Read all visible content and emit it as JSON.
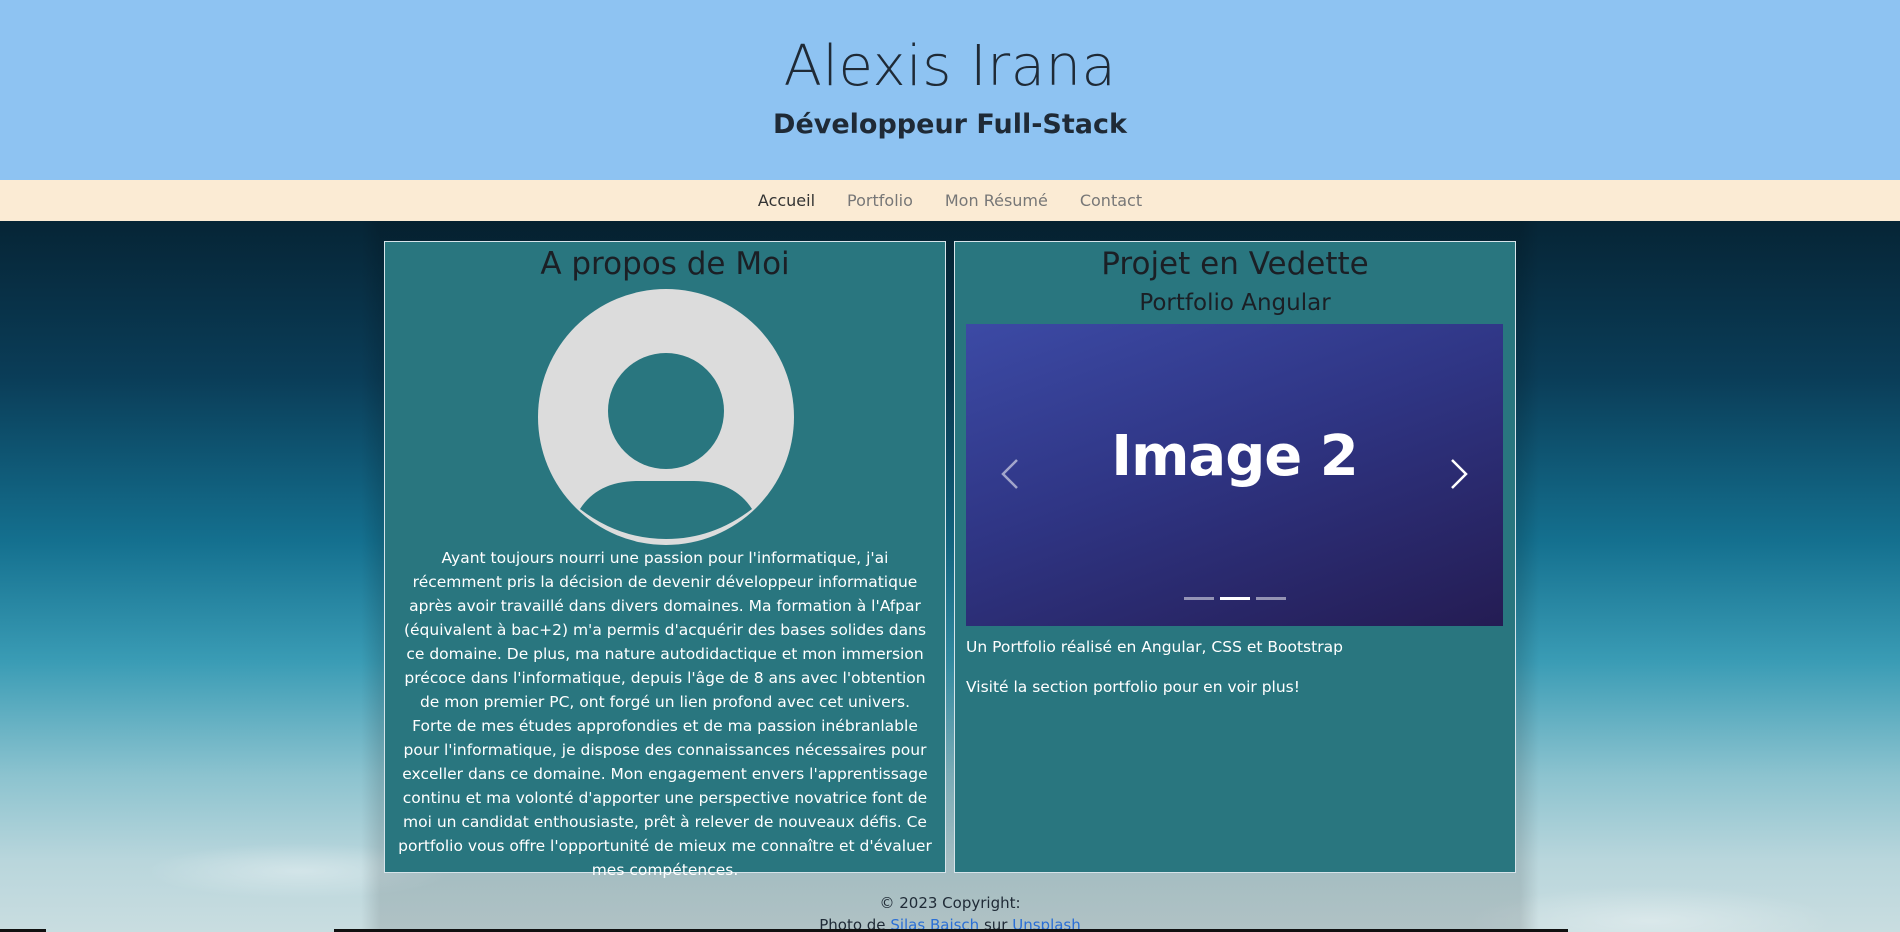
{
  "header": {
    "name": "Alexis Irana",
    "role": "Développeur Full-Stack"
  },
  "nav": {
    "items": [
      "Accueil",
      "Portfolio",
      "Mon Résumé",
      "Contact"
    ],
    "active": "Accueil"
  },
  "about": {
    "title": "A propos de Moi",
    "avatar_icon": "user-avatar-icon",
    "paragraph1": "Ayant toujours nourri une passion pour l'informatique, j'ai récemment pris la décision de devenir développeur informatique après avoir travaillé dans divers domaines. Ma formation à l'Afpar (équivalent à bac+2) m'a permis d'acquérir des bases solides dans ce domaine. De plus, ma nature autodidactique et mon immersion précoce dans l'informatique, depuis l'âge de 8 ans avec l'obtention de mon premier PC, ont forgé un lien profond avec cet univers.",
    "paragraph2": "Forte de mes études approfondies et de ma passion inébranlable pour l'informatique, je dispose des connaissances nécessaires pour exceller dans ce domaine. Mon engagement envers l'apprentissage continu et ma volonté d'apporter une perspective novatrice font de moi un candidat enthousiaste, prêt à relever de nouveaux défis. Ce portfolio vous offre l'opportunité de mieux me connaître et d'évaluer mes compétences."
  },
  "project": {
    "title": "Projet en Vedette",
    "subtitle": "Portfolio Angular",
    "slide_label": "Image 2",
    "indicators": 3,
    "active_indicator": 2,
    "prev_icon": "chevron-left-icon",
    "next_icon": "chevron-right-icon",
    "description": "Un Portfolio réalisé en Angular, CSS et Bootstrap",
    "cta": "Visité la section portfolio pour en voir plus!"
  },
  "footer": {
    "copyright": "© 2023 Copyright:",
    "photo_prefix": "Photo de",
    "photographer": "Silas Baisch",
    "on": "sur",
    "source": "Unsplash"
  },
  "colors": {
    "header_bg": "#8ec3f2",
    "nav_bg": "#fbebd4",
    "card_bg": "#29767f",
    "carousel_bg": "#2f3584"
  }
}
